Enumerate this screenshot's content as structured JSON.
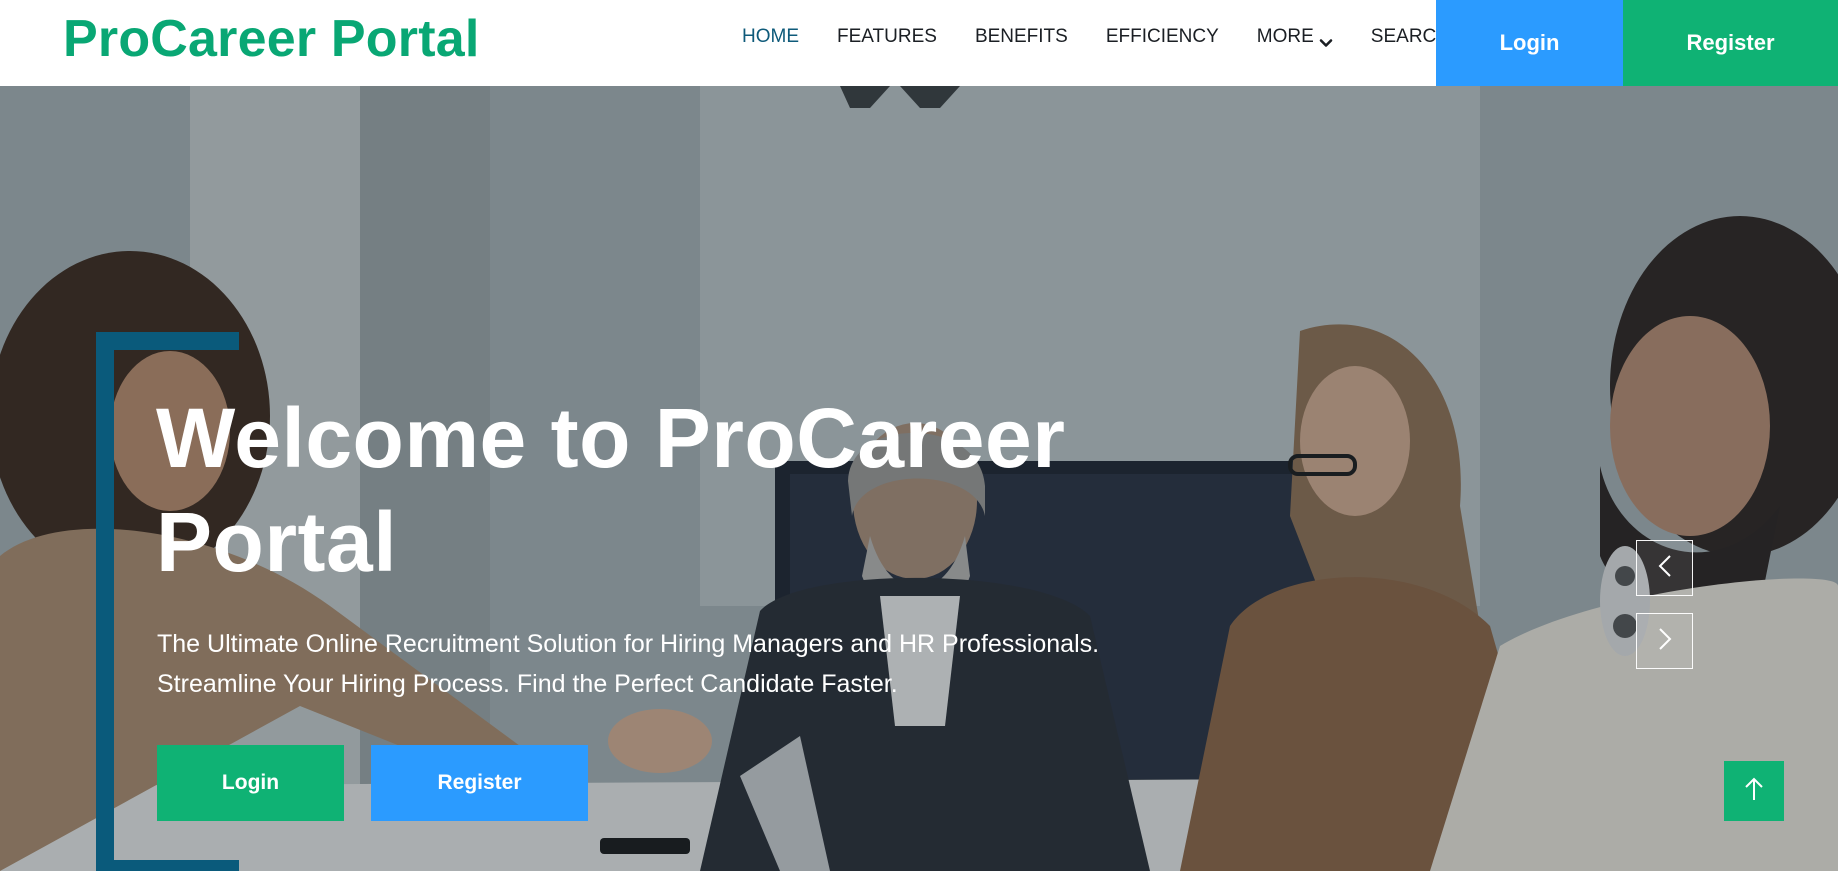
{
  "header": {
    "brand": "ProCareer Portal",
    "nav": [
      {
        "label": "HOME",
        "active": true
      },
      {
        "label": "FEATURES",
        "active": false
      },
      {
        "label": "BENEFITS",
        "active": false
      },
      {
        "label": "EFFICIENCY",
        "active": false
      },
      {
        "label": "MORE",
        "active": false,
        "icon": "chevron-down-icon"
      },
      {
        "label": "SEARCH",
        "active": false
      }
    ],
    "login_label": "Login",
    "register_label": "Register"
  },
  "hero": {
    "title": "Welcome to ProCareer Portal",
    "subtitle_line1": "The Ultimate Online Recruitment Solution for Hiring Managers and HR Professionals.",
    "subtitle_line2": "Streamline Your Hiring Process. Find the Perfect Candidate Faster.",
    "login_label": "Login",
    "register_label": "Register",
    "carousel_prev_icon": "chevron-left-icon",
    "carousel_next_icon": "chevron-right-icon",
    "back_to_top_icon": "arrow-up-icon"
  },
  "colors": {
    "brand_green": "#09a774",
    "button_green": "#0fb274",
    "button_blue": "#2b9bff",
    "accent_teal": "#0a5a7b",
    "nav_active": "#0e5a7a"
  }
}
